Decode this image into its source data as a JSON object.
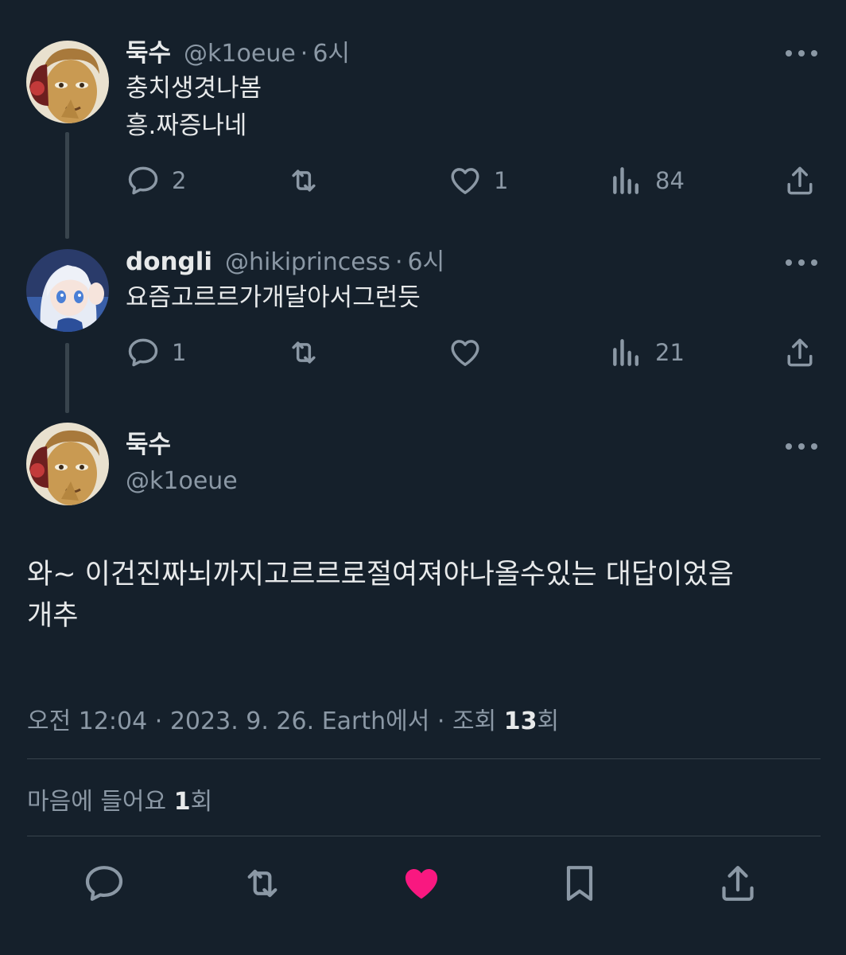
{
  "tweets": [
    {
      "name": "둑수",
      "handle": "@k1oeue",
      "separator": "·",
      "time": "6시",
      "lines": [
        "충치생겻나봄",
        "흥.짜증나네"
      ],
      "stats": {
        "replies": "2",
        "retweets": "",
        "likes": "1",
        "views": "84"
      }
    },
    {
      "name": "dongli",
      "handle": "@hikiprincess",
      "separator": "·",
      "time": "6시",
      "lines": [
        "요즘고르르가개달아서그런듯"
      ],
      "stats": {
        "replies": "1",
        "retweets": "",
        "likes": "",
        "views": "21"
      }
    }
  ],
  "main_tweet": {
    "name": "둑수",
    "handle": "@k1oeue",
    "lines": [
      "와~ 이건진짜뇌까지고르르로절여져야나올수있는 대답이었음",
      "개추"
    ],
    "meta": {
      "time": "오전 12:04",
      "separator": "·",
      "date": "2023. 9. 26.",
      "source": "Earth에서",
      "views_label": "조회",
      "views_count": "13",
      "views_suffix": "회"
    },
    "likes_row": {
      "label": "마음에 들어요",
      "count": "1",
      "suffix": "회"
    }
  },
  "icons": {
    "reply": "reply-icon",
    "retweet": "retweet-icon",
    "like": "heart-icon",
    "views": "views-icon",
    "share": "share-icon",
    "bookmark": "bookmark-icon",
    "more": "more-icon"
  },
  "colors": {
    "background": "#15202b",
    "text": "#e7e9ea",
    "muted": "#8b98a5",
    "liked": "#f91880"
  }
}
